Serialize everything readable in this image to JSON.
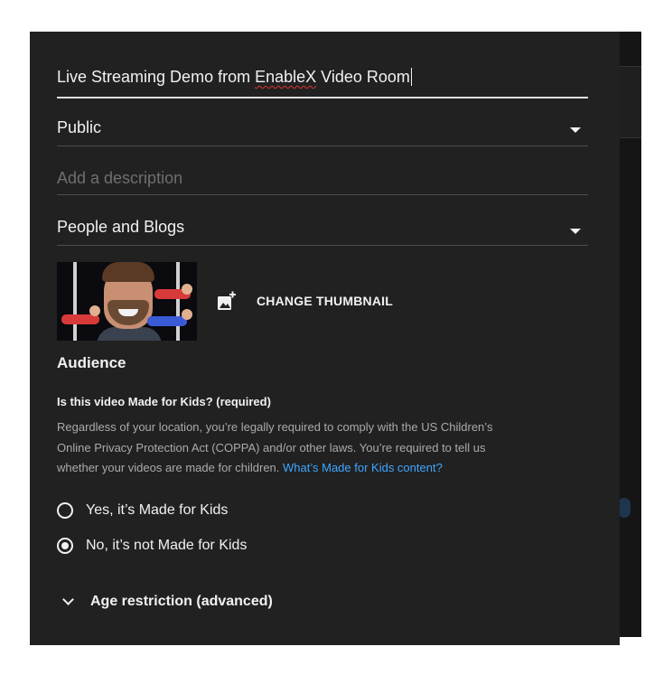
{
  "form": {
    "title_prefix": "Live Streaming Demo from ",
    "title_misspelled": "EnableX",
    "title_suffix": " Video Room",
    "visibility": "Public",
    "description_placeholder": "Add a description",
    "category": "People and Blogs"
  },
  "thumbnail": {
    "change_label": "CHANGE THUMBNAIL",
    "icon": "add-photo-icon"
  },
  "audience": {
    "heading": "Audience",
    "question": "Is this video Made for Kids? (required)",
    "legal_line1": "Regardless of your location, you’re legally required to comply with the US Children’s",
    "legal_line2": "Online Privacy Protection Act (COPPA) and/or other laws. You’re required to tell us",
    "legal_line3": "whether your videos are made for children. ",
    "legal_link": "What’s Made for Kids content?",
    "options": [
      {
        "label": "Yes, it’s Made for Kids",
        "selected": false
      },
      {
        "label": "No, it’s not Made for Kids",
        "selected": true
      }
    ],
    "age_restriction_label": "Age restriction (advanced)"
  },
  "colors": {
    "panel_bg": "#212121",
    "text": "#f1f1f1",
    "muted_text": "#aaaaaa",
    "link": "#3ea6ff"
  }
}
